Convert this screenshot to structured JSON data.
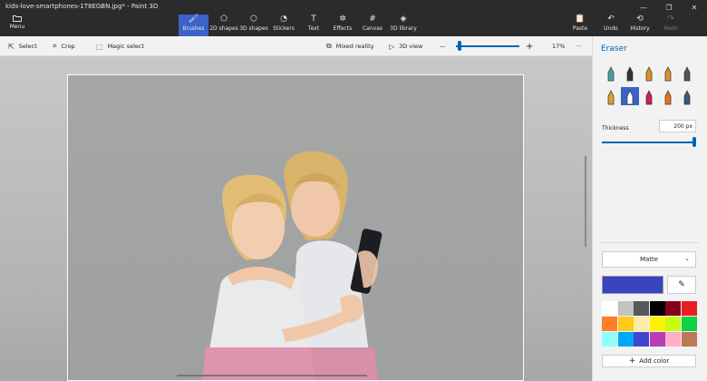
{
  "window": {
    "title": "kids-love-smartphones-1T8EGBN.jpg* - Paint 3D",
    "min": "—",
    "max": "❐",
    "close": "✕"
  },
  "ribbon": {
    "menu": "Menu",
    "tools": [
      "Brushes",
      "2D shapes",
      "3D shapes",
      "Stickers",
      "Text",
      "Effects",
      "Canvas",
      "3D library"
    ],
    "paste": "Paste",
    "undo": "Undo",
    "history": "History",
    "redo": "Redo"
  },
  "commandbar": {
    "select": "Select",
    "crop": "Crop",
    "magic_select": "Magic select",
    "mixed_reality": "Mixed reality",
    "view_3d": "3D view",
    "zoom_minus": "—",
    "zoom_plus": "+",
    "zoom": "17%",
    "more": "···",
    "zoom_level": 0.03
  },
  "panel": {
    "title": "Eraser",
    "thickness_label": "Thickness",
    "thickness_value": "200 px",
    "thickness_level": 1.0,
    "finish": "Matte",
    "add_color": "Add color",
    "current_color": "#3a42c0",
    "brushes": [
      {
        "name": "marker-brush-icon",
        "color": "#4aa0a0"
      },
      {
        "name": "calligraphy-pen-icon",
        "color": "#333333"
      },
      {
        "name": "oil-brush-icon",
        "color": "#e0902a"
      },
      {
        "name": "watercolor-brush-icon",
        "color": "#e0902a"
      },
      {
        "name": "pixel-pen-icon",
        "color": "#555555"
      },
      {
        "name": "pencil-icon",
        "color": "#e0a030"
      },
      {
        "name": "eraser-icon",
        "color": "#ffffff"
      },
      {
        "name": "crayon-icon",
        "color": "#d21d4e"
      },
      {
        "name": "spray-can-icon",
        "color": "#ec6f1a"
      },
      {
        "name": "fill-bucket-icon",
        "color": "#3a5a7a"
      }
    ],
    "palette": [
      "#ffffff",
      "#c3c3c3",
      "#585858",
      "#000000",
      "#88001b",
      "#ec1c24",
      "#ff7f27",
      "#ffca18",
      "#fdeca6",
      "#fff200",
      "#c4ff0e",
      "#0ed145",
      "#8cfffb",
      "#00a8f3",
      "#3f48cc",
      "#b83dba",
      "#ffaec8",
      "#b97a56"
    ]
  }
}
